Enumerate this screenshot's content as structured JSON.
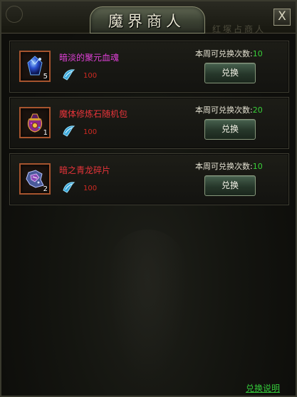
{
  "window": {
    "title": "魔界商人",
    "watermark": "红塚占商人",
    "close_label": "X"
  },
  "items": [
    {
      "name": "暗淡的聚元血魂",
      "name_color": "#e040d8",
      "quantity": "5",
      "cost": "100",
      "limit_label": "本周可兑换次数:",
      "limit_value": "10",
      "button_label": "兑换",
      "icon": "blue-gem-icon"
    },
    {
      "name": "魔体修炼石随机包",
      "name_color": "#e8343a",
      "quantity": "1",
      "cost": "100",
      "limit_label": "本周可兑换次数:",
      "limit_value": "20",
      "button_label": "兑换",
      "icon": "treasure-bag-icon"
    },
    {
      "name": "暗之青龙碎片",
      "name_color": "#e8343a",
      "quantity": "2",
      "cost": "100",
      "limit_label": "本周可兑换次数:",
      "limit_value": "10",
      "button_label": "兑换",
      "icon": "dragon-fragment-icon"
    }
  ],
  "footer": {
    "help_label": "兑换说明"
  },
  "colors": {
    "limit_value": "#39d139",
    "cost": "#d02a22",
    "help_link": "#34c83a"
  }
}
